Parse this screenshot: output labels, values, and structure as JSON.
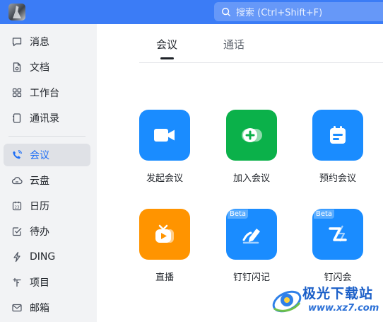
{
  "colors": {
    "topbar": "#3b7cf6",
    "accent": "#1f6ff5",
    "tile_blue": "#1a8cff",
    "tile_green": "#0bb14a",
    "tile_orange": "#ff9400"
  },
  "search": {
    "placeholder": "搜索 (Ctrl+Shift+F)",
    "icon": "search-icon"
  },
  "sidebar": {
    "items": [
      {
        "label": "消息",
        "icon": "chat-bubble-icon"
      },
      {
        "label": "文档",
        "icon": "document-icon"
      },
      {
        "label": "工作台",
        "icon": "grid-icon"
      },
      {
        "label": "通讯录",
        "icon": "contacts-icon"
      },
      {
        "label": "会议",
        "icon": "phone-icon",
        "active": true
      },
      {
        "label": "云盘",
        "icon": "cloud-icon"
      },
      {
        "label": "日历",
        "icon": "calendar-icon"
      },
      {
        "label": "待办",
        "icon": "todo-check-icon"
      },
      {
        "label": "DING",
        "icon": "lightning-icon"
      },
      {
        "label": "项目",
        "icon": "project-icon"
      },
      {
        "label": "邮箱",
        "icon": "mail-icon"
      }
    ]
  },
  "main": {
    "tabs": [
      {
        "label": "会议",
        "active": true
      },
      {
        "label": "通话",
        "active": false
      }
    ],
    "tiles": [
      {
        "label": "发起会议",
        "icon": "video-camera-icon",
        "color": "#1a8cff"
      },
      {
        "label": "加入会议",
        "icon": "join-plus-icon",
        "color": "#0bb14a"
      },
      {
        "label": "预约会议",
        "icon": "calendar-schedule-icon",
        "color": "#1a8cff"
      },
      {
        "label": "直播",
        "icon": "live-tv-icon",
        "color": "#ff9400"
      },
      {
        "label": "钉钉闪记",
        "icon": "pen-note-icon",
        "color": "#1a8cff",
        "badge": "Beta"
      },
      {
        "label": "钉闪会",
        "icon": "flash-meeting-icon",
        "color": "#1a8cff",
        "badge": "Beta"
      }
    ]
  },
  "watermark": {
    "title": "极光下载站",
    "url": "www.xz7.com"
  }
}
